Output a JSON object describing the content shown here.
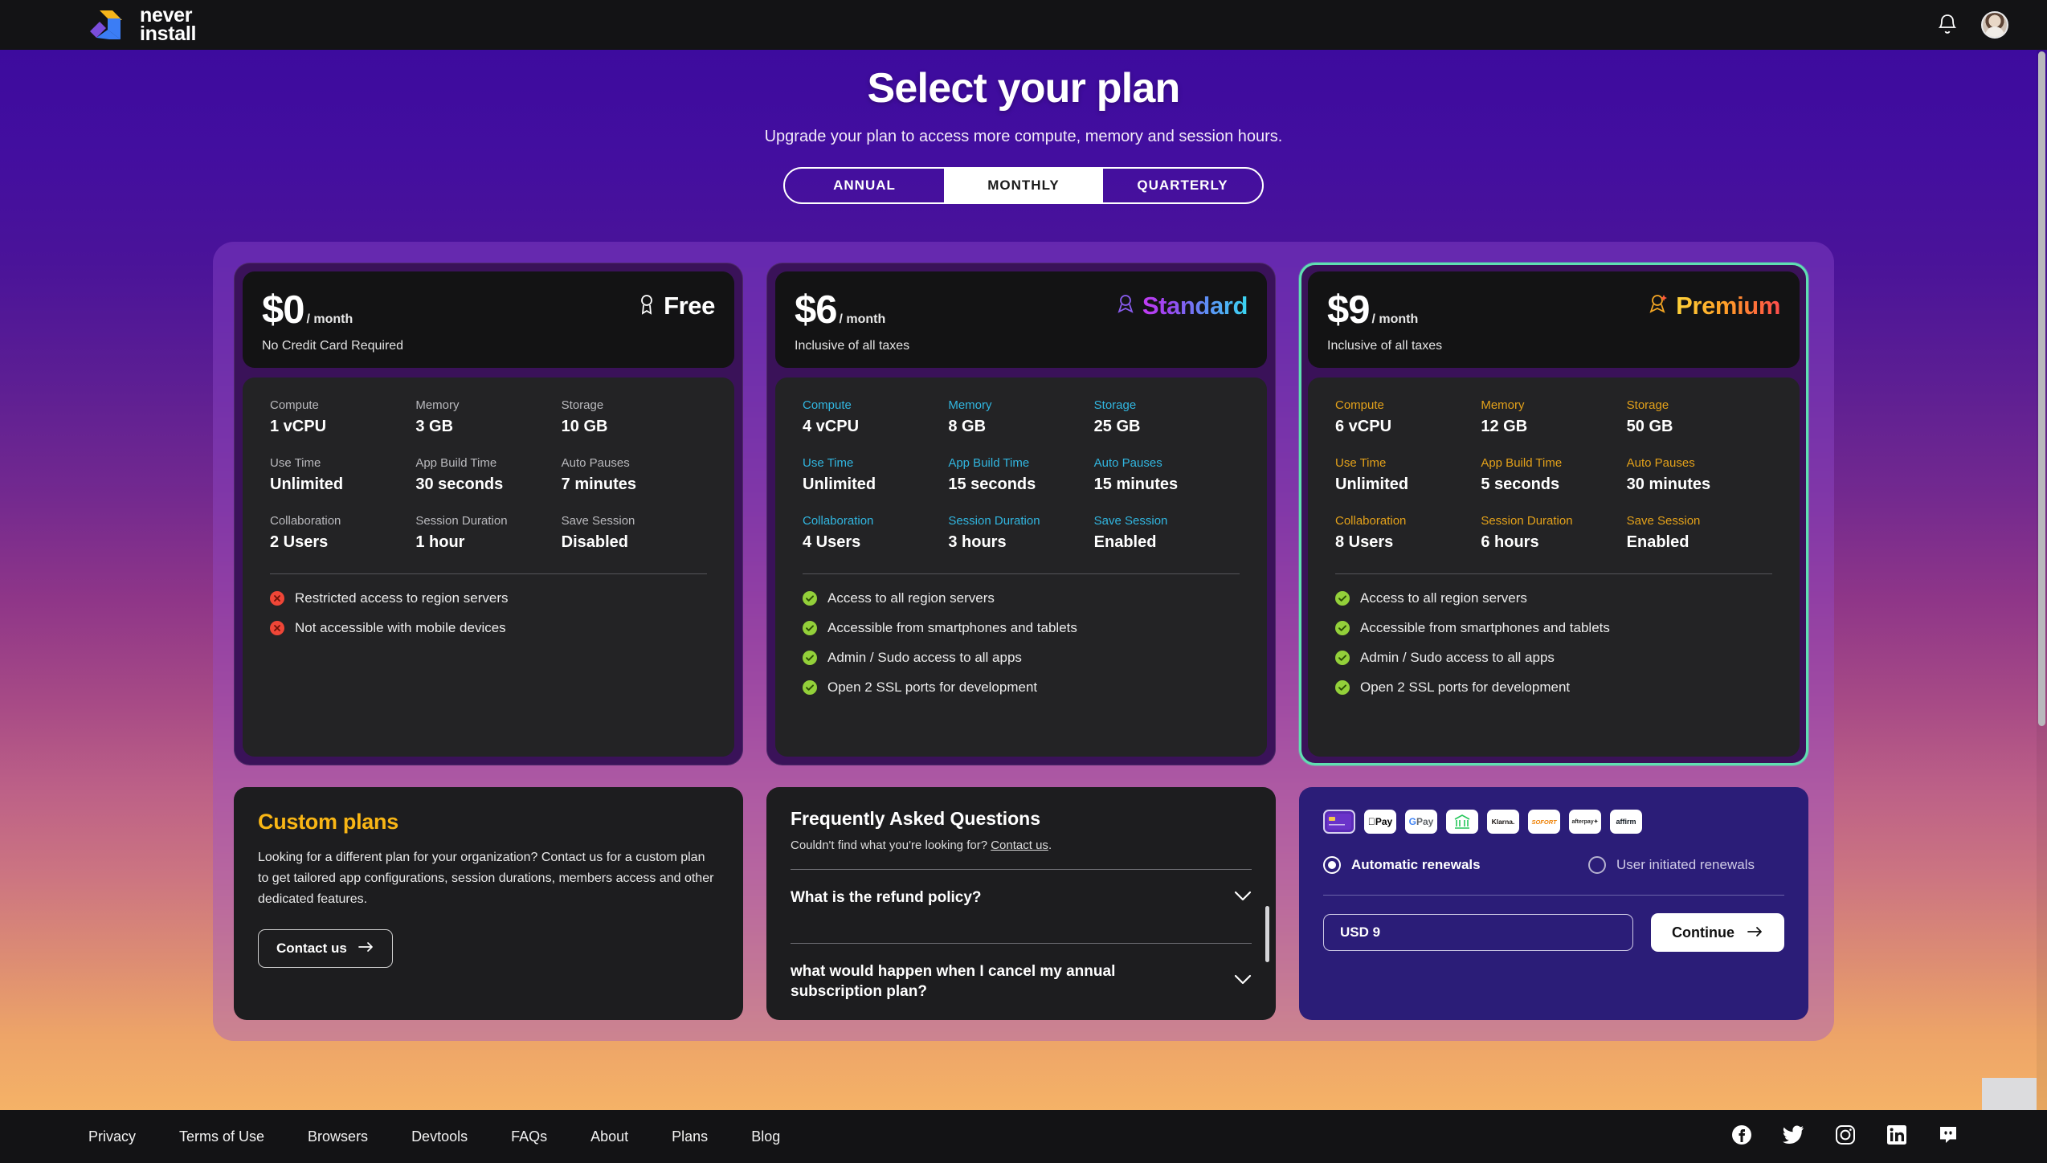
{
  "topbar": {
    "brand_line1": "never",
    "brand_line2": "install",
    "bell_label": "Notifications",
    "avatar_label": "Account"
  },
  "hero": {
    "title": "Select your plan",
    "subtitle": "Upgrade your plan to access more compute, memory and session hours.",
    "billing_cycles": [
      {
        "label": "ANNUAL",
        "active": false
      },
      {
        "label": "MONTHLY",
        "active": true
      },
      {
        "label": "QUARTERLY",
        "active": false
      }
    ]
  },
  "spec_labels": {
    "compute": "Compute",
    "memory": "Memory",
    "storage": "Storage",
    "use_time": "Use Time",
    "app_build_time": "App Build Time",
    "auto_pauses": "Auto Pauses",
    "collaboration": "Collaboration",
    "session_duration": "Session Duration",
    "save_session": "Save Session"
  },
  "plans": [
    {
      "id": "free",
      "price": "$0",
      "per": "/ month",
      "subnote": "No Credit Card Required",
      "tier": "Free",
      "tier_icon": "award-ribbon-icon",
      "featured": false,
      "specs": {
        "compute": "1 vCPU",
        "memory": "3 GB",
        "storage": "10 GB",
        "use_time": "Unlimited",
        "app_build_time": "30 seconds",
        "auto_pauses": "7 minutes",
        "collaboration": "2 Users",
        "session_duration": "1 hour",
        "save_session": "Disabled"
      },
      "features": [
        {
          "text": "Restricted access to region servers",
          "included": false
        },
        {
          "text": "Not accessible with mobile devices",
          "included": false
        }
      ]
    },
    {
      "id": "standard",
      "price": "$6",
      "per": "/ month",
      "subnote": "Inclusive of all taxes",
      "tier": "Standard",
      "tier_icon": "award-ribbon-icon",
      "featured": false,
      "specs": {
        "compute": "4 vCPU",
        "memory": "8 GB",
        "storage": "25 GB",
        "use_time": "Unlimited",
        "app_build_time": "15 seconds",
        "auto_pauses": "15 minutes",
        "collaboration": "4 Users",
        "session_duration": "3 hours",
        "save_session": "Enabled"
      },
      "features": [
        {
          "text": "Access to all region servers",
          "included": true
        },
        {
          "text": "Accessible from smartphones and tablets",
          "included": true
        },
        {
          "text": "Admin / Sudo access to all apps",
          "included": true
        },
        {
          "text": "Open 2 SSL ports for development",
          "included": true
        }
      ]
    },
    {
      "id": "premium",
      "price": "$9",
      "per": "/ month",
      "subnote": "Inclusive of all taxes",
      "tier": "Premium",
      "tier_icon": "award-ribbon-star-icon",
      "featured": true,
      "specs": {
        "compute": "6 vCPU",
        "memory": "12 GB",
        "storage": "50 GB",
        "use_time": "Unlimited",
        "app_build_time": "5 seconds",
        "auto_pauses": "30 minutes",
        "collaboration": "8 Users",
        "session_duration": "6 hours",
        "save_session": "Enabled"
      },
      "features": [
        {
          "text": "Access to all region servers",
          "included": true
        },
        {
          "text": "Accessible from smartphones and tablets",
          "included": true
        },
        {
          "text": "Admin / Sudo access to all apps",
          "included": true
        },
        {
          "text": "Open 2 SSL ports for development",
          "included": true
        }
      ]
    }
  ],
  "custom_plans": {
    "title": "Custom plans",
    "body": "Looking for a different plan for your organization? Contact us for a custom plan to get tailored app configurations, session durations, members access and other dedicated features.",
    "button": "Contact us"
  },
  "faq": {
    "title": "Frequently Asked Questions",
    "sub_prefix": "Couldn't find what you're looking for?",
    "sub_link": "Contact us",
    "sub_suffix": ".",
    "items": [
      {
        "question": "What is the refund policy?"
      },
      {
        "question": "what would happen when I cancel my annual subscription plan?"
      }
    ]
  },
  "checkout": {
    "payment_methods": [
      {
        "name": "credit-card-icon",
        "label": "Card"
      },
      {
        "name": "apple-pay-icon",
        "label": "Pay"
      },
      {
        "name": "google-pay-icon",
        "label": "Pay"
      },
      {
        "name": "bank-transfer-icon",
        "label": "Bank"
      },
      {
        "name": "klarna-icon",
        "label": "Klarna."
      },
      {
        "name": "sofort-icon",
        "label": "SOFORT"
      },
      {
        "name": "afterpay-icon",
        "label": "afterpay"
      },
      {
        "name": "affirm-icon",
        "label": "affirm"
      }
    ],
    "renewal_options": [
      {
        "label": "Automatic renewals",
        "selected": true
      },
      {
        "label": "User initiated renewals",
        "selected": false
      }
    ],
    "amount": "USD 9",
    "continue_label": "Continue"
  },
  "footer": {
    "links": [
      "Privacy",
      "Terms of Use",
      "Browsers",
      "Devtools",
      "FAQs",
      "About",
      "Plans",
      "Blog"
    ],
    "social": [
      "facebook-icon",
      "twitter-icon",
      "instagram-icon",
      "linkedin-icon",
      "discord-icon"
    ]
  },
  "colors": {
    "accent_purple": "#3d0b9e",
    "accent_orange": "#f5b267",
    "featured_border": "#5fe0b2",
    "custom_title": "#f9b615",
    "checkout_bg": "#2b1d78",
    "yes_icon": "#93d03a",
    "no_icon": "#ef4637"
  }
}
